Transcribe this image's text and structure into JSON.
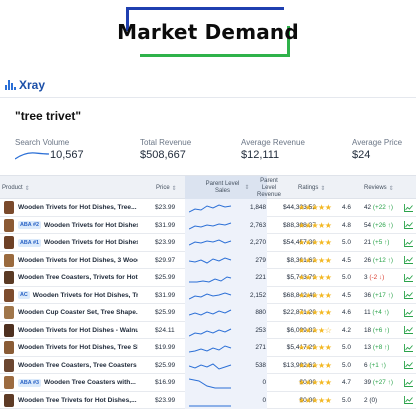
{
  "banner": {
    "title": "Market Demand"
  },
  "toolbar": {
    "app_name": "Xray"
  },
  "search": {
    "query": "\"tree trivet\""
  },
  "stats": {
    "search_volume_label": "Search Volume",
    "search_volume": "10,567",
    "total_revenue_label": "Total Revenue",
    "total_revenue": "$508,667",
    "avg_revenue_label": "Average Revenue",
    "avg_revenue": "$12,111",
    "avg_price_label": "Average Price",
    "avg_price": "$24"
  },
  "table": {
    "headers": {
      "product": "Product",
      "price": "Price",
      "sales": "Parent Level Sales",
      "revenue": "Parent Level Revenue",
      "ratings": "Ratings",
      "reviews": "Reviews"
    },
    "rows": [
      {
        "badge": "",
        "title": "Wooden Trivets for Hot Dishes,  Tree...",
        "price": "$23.99",
        "sales": "1,848",
        "revenue": "$44,333.52",
        "stars": "★★★★★",
        "rating": "4.6",
        "reviews": "42",
        "delta": "(+22 ↑)",
        "dir": "pos",
        "thumb": "#7a4a2c"
      },
      {
        "badge": "ABA #2",
        "title": "Wooden Trivets for Hot Dishes,...",
        "price": "$31.99",
        "sales": "2,763",
        "revenue": "$88,388.37",
        "stars": "★★★★★",
        "rating": "4.8",
        "reviews": "54",
        "delta": "(+26 ↑)",
        "dir": "pos",
        "thumb": "#8b5a34"
      },
      {
        "badge": "ABA #1",
        "title": "Wooden Trivets for Hot Dishes,...",
        "price": "$23.99",
        "sales": "2,270",
        "revenue": "$54,457.30",
        "stars": "★★★★★",
        "rating": "5.0",
        "reviews": "21",
        "delta": "(+5 ↑)",
        "dir": "pos",
        "thumb": "#6e4126"
      },
      {
        "badge": "",
        "title": "Wooden Trivets for Hot Dishes, 3 Woode...",
        "price": "$29.97",
        "sales": "279",
        "revenue": "$8,361.63",
        "stars": "★★★★★",
        "rating": "4.5",
        "reviews": "26",
        "delta": "(+12 ↑)",
        "dir": "pos",
        "thumb": "#9a6a3e"
      },
      {
        "badge": "",
        "title": "Wooden Tree Coasters, Trivets for Hot...",
        "price": "$25.99",
        "sales": "221",
        "revenue": "$5,743.79",
        "stars": "★★★★★",
        "rating": "5.0",
        "reviews": "3",
        "delta": "(-2 ↓)",
        "dir": "neg",
        "thumb": "#5a3a24"
      },
      {
        "badge": "AC",
        "title": "Wooden Trivets for Hot Dishes, Tree...",
        "price": "$31.99",
        "sales": "2,152",
        "revenue": "$68,842.48",
        "stars": "★★★★★",
        "rating": "4.5",
        "reviews": "36",
        "delta": "(+17 ↑)",
        "dir": "pos",
        "thumb": "#7d4c2e"
      },
      {
        "badge": "",
        "title": "Wooden Cup Coaster Set,  Tree Shape...",
        "price": "$25.99",
        "sales": "880",
        "revenue": "$22,871.20",
        "stars": "★★★★★",
        "rating": "4.6",
        "reviews": "11",
        "delta": "(+4 ↑)",
        "dir": "pos",
        "thumb": "#a0764a"
      },
      {
        "badge": "",
        "title": "Wooden Trivets for Hot Dishes - Walnut...",
        "price": "$24.11",
        "sales": "253",
        "revenue": "$6,099.83",
        "stars": "★★★★☆",
        "rating": "4.2",
        "reviews": "18",
        "delta": "(+6 ↑)",
        "dir": "pos",
        "thumb": "#4e3020"
      },
      {
        "badge": "",
        "title": "Wooden Trivets for Hot Dishes, Tree Sha...",
        "price": "$19.99",
        "sales": "271",
        "revenue": "$5,417.29",
        "stars": "★★★★★",
        "rating": "5.0",
        "reviews": "13",
        "delta": "(+8 ↑)",
        "dir": "pos",
        "thumb": "#8a5c36"
      },
      {
        "badge": "",
        "title": "Wooden Tree Coasters,  Tree Coasters S...",
        "price": "$25.99",
        "sales": "538",
        "revenue": "$13,982.62",
        "stars": "★★★★★",
        "rating": "5.0",
        "reviews": "6",
        "delta": "(+1 ↑)",
        "dir": "pos",
        "thumb": "#6b4630"
      },
      {
        "badge": "ABA #3",
        "title": "Wooden Tree Coasters with...",
        "price": "$16.99",
        "sales": "0",
        "revenue": "$0.00",
        "stars": "★★★★★",
        "rating": "4.7",
        "reviews": "39",
        "delta": "(+27 ↑)",
        "dir": "pos",
        "thumb": "#9c6b40"
      },
      {
        "badge": "",
        "title": "Wooden Tree Trivets for Hot Dishes,...",
        "price": "$23.99",
        "sales": "0",
        "revenue": "$0.00",
        "stars": "★★★★★",
        "rating": "5.0",
        "reviews": "2",
        "delta": "(0)",
        "dir": "neu",
        "thumb": "#5e3b26"
      }
    ]
  },
  "colors": {
    "accent": "#2b6fd6",
    "star": "#f3b824",
    "positive": "#2aa34a",
    "negative": "#d93a2c",
    "frame_blue": "#1f3fb0",
    "frame_green": "#2fb24a"
  },
  "icons": {
    "app": "bar-chart-icon",
    "trend": "trend-chart-icon",
    "sort": "sort-icon"
  }
}
